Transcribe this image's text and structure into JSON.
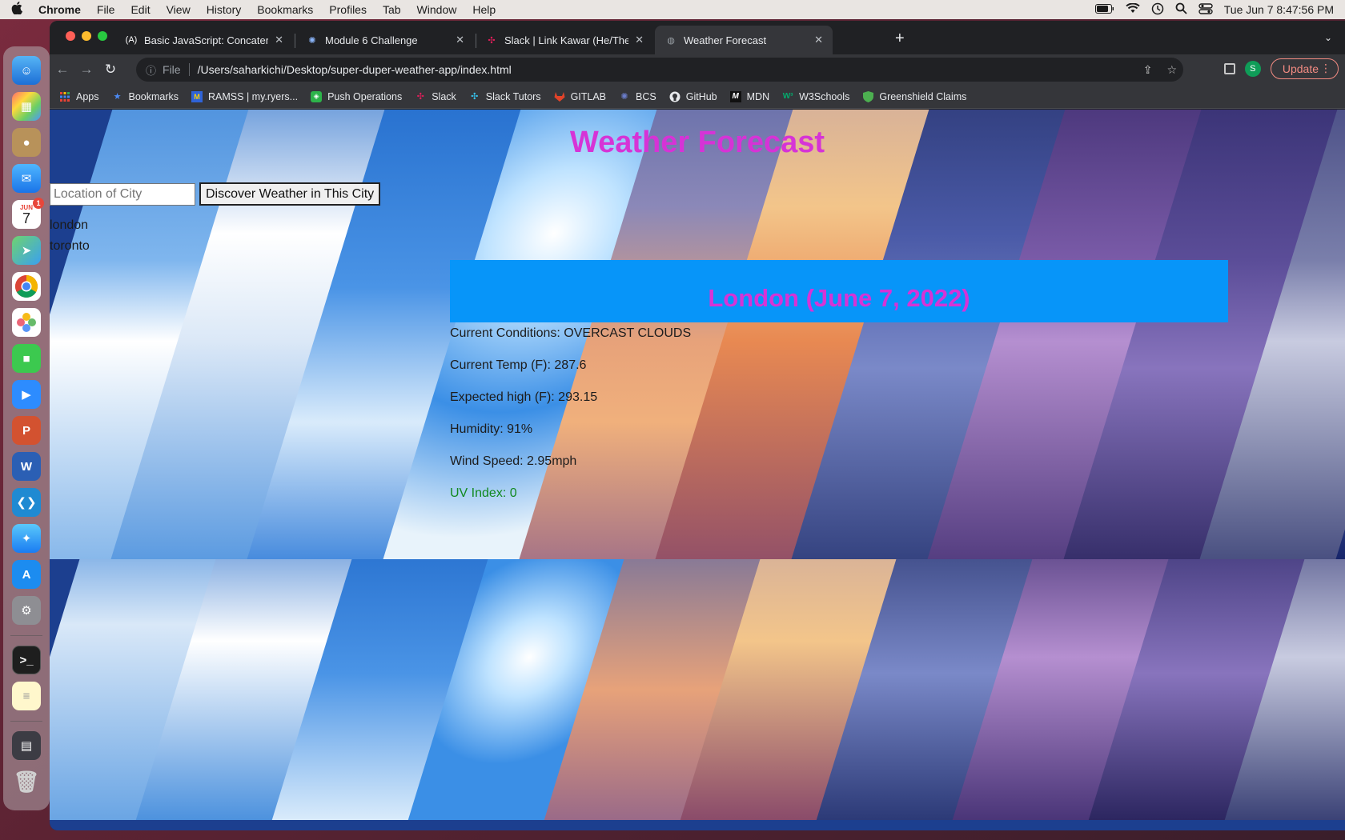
{
  "menubar": {
    "app": "Chrome",
    "items": [
      "File",
      "Edit",
      "View",
      "History",
      "Bookmarks",
      "Profiles",
      "Tab",
      "Window",
      "Help"
    ],
    "clock": "Tue Jun 7  8:47:56 PM"
  },
  "dock": {
    "calendar_month": "JUN",
    "calendar_day": "7",
    "calendar_badge": "1"
  },
  "tabs": [
    {
      "title": "Basic JavaScript: Concatenatin",
      "icon": "freecodecamp-icon"
    },
    {
      "title": "Module 6 Challenge",
      "icon": "canvas-icon"
    },
    {
      "title": "Slack | Link Kawar (He/They) | ",
      "icon": "slack-icon"
    },
    {
      "title": "Weather Forecast",
      "icon": "globe-icon"
    }
  ],
  "address": {
    "scheme": "File",
    "url": "/Users/saharkichi/Desktop/super-duper-weather-app/index.html"
  },
  "toolbar": {
    "update_label": "Update",
    "avatar_letter": "S"
  },
  "bookmarks": [
    {
      "label": "Apps",
      "icon": "apps-grid-icon",
      "color": "#e8eaed"
    },
    {
      "label": "Bookmarks",
      "icon": "star-icon",
      "color": "#4c8bf5"
    },
    {
      "label": "RAMSS | my.ryers...",
      "icon": "ramss-icon",
      "color": "#2f63d8"
    },
    {
      "label": "Push Operations",
      "icon": "push-icon",
      "color": "#2db34a"
    },
    {
      "label": "Slack",
      "icon": "slack-icon",
      "color": "#e01e5a"
    },
    {
      "label": "Slack Tutors",
      "icon": "slack-icon",
      "color": "#36c5f0"
    },
    {
      "label": "GITLAB",
      "icon": "gitlab-icon",
      "color": "#e24329"
    },
    {
      "label": "BCS",
      "icon": "bcs-icon",
      "color": "#6a7cc9"
    },
    {
      "label": "GitHub",
      "icon": "github-icon",
      "color": "#e8eaed"
    },
    {
      "label": "MDN",
      "icon": "mdn-icon",
      "color": "#e8eaed"
    },
    {
      "label": "W3Schools",
      "icon": "w3schools-icon",
      "color": "#04aa6d"
    },
    {
      "label": "Greenshield Claims",
      "icon": "shield-icon",
      "color": "#4caf50"
    }
  ],
  "page": {
    "title": "Weather Forecast",
    "search_placeholder": "Location of City",
    "search_button": "Discover Weather in This City",
    "history": [
      "london",
      "toronto"
    ],
    "city_heading": "London (June 7, 2022)",
    "conditions": "Current Conditions: OVERCAST CLOUDS",
    "temp": "Current Temp (F): 287.6",
    "high": "Expected high (F): 293.15",
    "humidity": "Humidity: 91%",
    "wind": "Wind Speed: 2.95mph",
    "uv": "UV Index: 0"
  },
  "colors": {
    "title": "#d633d6",
    "banner": "#0795f9",
    "uv_good": "#11891f"
  }
}
